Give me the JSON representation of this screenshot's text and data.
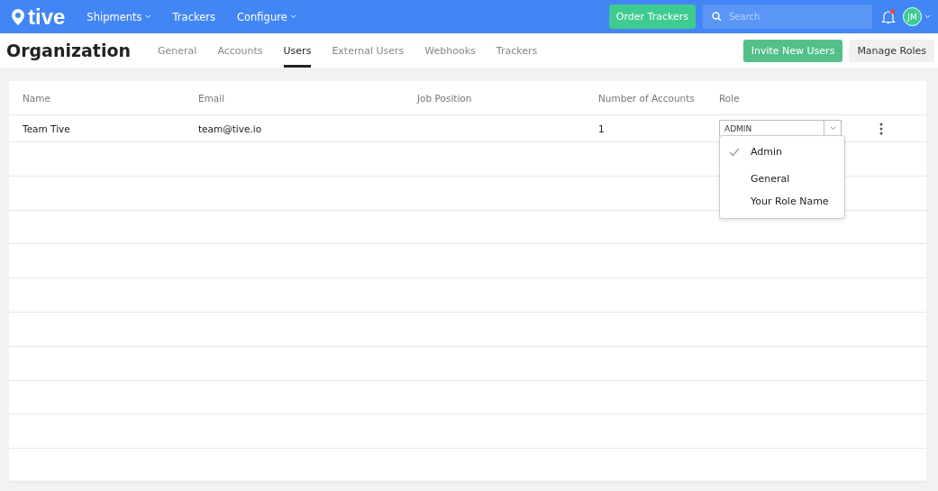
{
  "topbar": {
    "logo": "tive",
    "nav": [
      {
        "label": "Shipments",
        "dropdown": true
      },
      {
        "label": "Trackers",
        "dropdown": false
      },
      {
        "label": "Configure",
        "dropdown": true
      }
    ],
    "order_button": "Order Trackers",
    "search": {
      "placeholder": "Search"
    },
    "notifications": {
      "unread": true
    },
    "avatar": {
      "initials": "JM"
    }
  },
  "header": {
    "title": "Organization",
    "tabs": [
      {
        "label": "General",
        "selected": false
      },
      {
        "label": "Accounts",
        "selected": false
      },
      {
        "label": "Users",
        "selected": true
      },
      {
        "label": "External Users",
        "selected": false
      },
      {
        "label": "Webhooks",
        "selected": false
      },
      {
        "label": "Trackers",
        "selected": false
      }
    ],
    "buttons": [
      {
        "label": "Invite New Users",
        "kind": "primary"
      },
      {
        "label": "Manage Roles",
        "kind": "secondary"
      }
    ]
  },
  "table": {
    "columns": [
      "Name",
      "Email",
      "Job Position",
      "Number of Accounts",
      "Role"
    ],
    "rows": [
      {
        "name": "Team Tive",
        "email": "team@tive.io",
        "job_position": "",
        "accounts": "1",
        "role": "ADMIN"
      }
    ]
  },
  "role_menu": {
    "options": [
      {
        "label": "Admin",
        "selected": true
      },
      {
        "label": "General",
        "selected": false
      },
      {
        "label": "Your Role Name",
        "selected": false
      }
    ]
  }
}
